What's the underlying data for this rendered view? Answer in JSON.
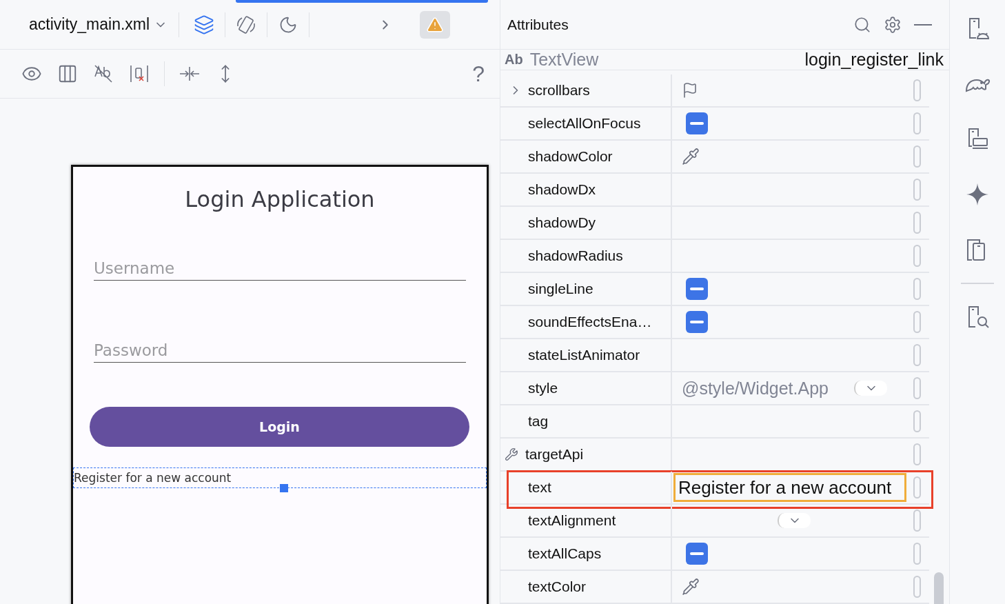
{
  "editor_toolbar": {
    "file": "activity_main.xml",
    "warning": true
  },
  "design_toolbar": {
    "help": "?"
  },
  "preview": {
    "title": "Login Application",
    "fields": [
      {
        "placeholder": "Username"
      },
      {
        "placeholder": "Password"
      }
    ],
    "button": "Login",
    "link": {
      "text": "Register for a new account",
      "selected": true
    }
  },
  "attributes": {
    "title": "Attributes",
    "component": {
      "badge": "Ab",
      "type": "TextView",
      "id": "login_register_link"
    },
    "rows": [
      {
        "name": "scrollbars",
        "kind": "flag",
        "expanded": false
      },
      {
        "name": "selectAllOnFocus",
        "kind": "tristate",
        "indeterminate": true
      },
      {
        "name": "shadowColor",
        "kind": "color"
      },
      {
        "name": "shadowDx",
        "kind": "text"
      },
      {
        "name": "shadowDy",
        "kind": "text"
      },
      {
        "name": "shadowRadius",
        "kind": "text"
      },
      {
        "name": "singleLine",
        "kind": "tristate",
        "indeterminate": true
      },
      {
        "name": "soundEffectsEna…",
        "kind": "tristate",
        "indeterminate": true
      },
      {
        "name": "stateListAnimator",
        "kind": "text"
      },
      {
        "name": "style",
        "kind": "dropdown",
        "value": "@style/Widget.App"
      },
      {
        "name": "tag",
        "kind": "text"
      },
      {
        "name": "targetApi",
        "kind": "text",
        "tools": true
      },
      {
        "name": "text",
        "kind": "text",
        "value": "Register for a new account",
        "highlighted": true
      },
      {
        "name": "textAlignment",
        "kind": "dropdown"
      },
      {
        "name": "textAllCaps",
        "kind": "tristate",
        "indeterminate": true
      },
      {
        "name": "textColor",
        "kind": "color"
      }
    ]
  }
}
